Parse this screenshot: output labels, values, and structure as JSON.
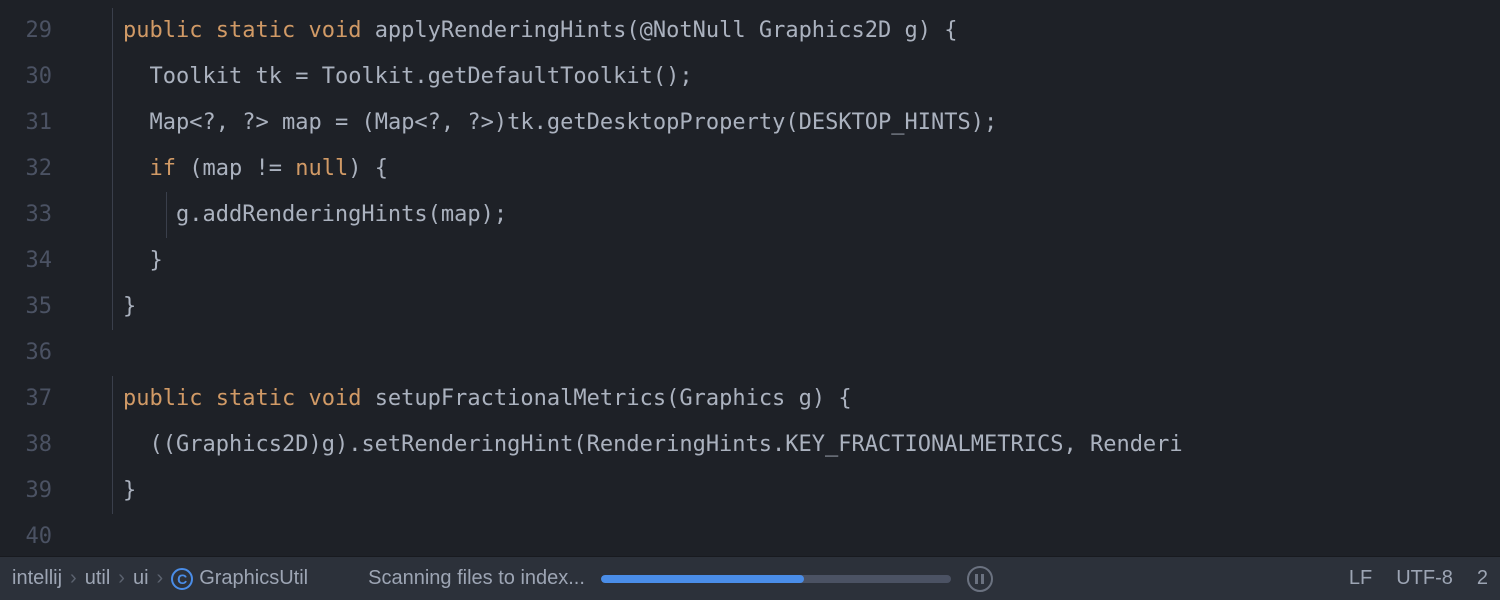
{
  "gutter": {
    "lines": [
      "29",
      "30",
      "31",
      "32",
      "33",
      "34",
      "35",
      "36",
      "37",
      "38",
      "39",
      "40"
    ]
  },
  "code": {
    "l29": {
      "public": "public",
      "static": "static",
      "void": "void",
      "method": "applyRenderingHints",
      "paren_open": "(",
      "anno": "@NotNull",
      "param_type": "Graphics2D",
      "param_name": "g",
      "paren_close": ")",
      "brace": "{"
    },
    "l30": {
      "type": "Toolkit",
      "var": "tk",
      "eq": "=",
      "cls": "Toolkit",
      "dot": ".",
      "call": "getDefaultToolkit",
      "parens": "()",
      "semi": ";"
    },
    "l31": {
      "type": "Map<?, ?>",
      "var": "map",
      "eq": "=",
      "cast": "(Map<?, ?>)",
      "obj": "tk",
      "dot": ".",
      "call": "getDesktopProperty",
      "paren_open": "(",
      "arg": "DESKTOP_HINTS",
      "paren_close": ")",
      "semi": ";"
    },
    "l32": {
      "if": "if",
      "paren_open": "(",
      "var": "map",
      "neq": "!=",
      "null": "null",
      "paren_close": ")",
      "brace": "{"
    },
    "l33": {
      "obj": "g",
      "dot": ".",
      "call": "addRenderingHints",
      "paren_open": "(",
      "arg": "map",
      "paren_close": ")",
      "semi": ";"
    },
    "l34": {
      "brace": "}"
    },
    "l35": {
      "brace": "}"
    },
    "l37": {
      "public": "public",
      "static": "static",
      "void": "void",
      "method": "setupFractionalMetrics",
      "paren_open": "(",
      "param_type": "Graphics",
      "param_name": "g",
      "paren_close": ")",
      "brace": "{"
    },
    "l38": {
      "cast_open": "((",
      "cast_type": "Graphics2D",
      "cast_close": ")",
      "obj": "g",
      "paren": ")",
      "dot": ".",
      "call": "setRenderingHint",
      "paren_open": "(",
      "cls": "RenderingHints",
      "dot2": ".",
      "const": "KEY_FRACTIONALMETRICS",
      "comma": ",",
      "tail": "Renderi"
    },
    "l39": {
      "brace": "}"
    }
  },
  "status": {
    "breadcrumbs": {
      "p1": "intellij",
      "p2": "util",
      "p3": "ui",
      "p4": "GraphicsUtil",
      "class_letter": "C",
      "sep": "›"
    },
    "task": "Scanning files to index...",
    "progress_pct": 58,
    "right": {
      "lf": "LF",
      "encoding": "UTF-8",
      "tab": "2"
    }
  }
}
